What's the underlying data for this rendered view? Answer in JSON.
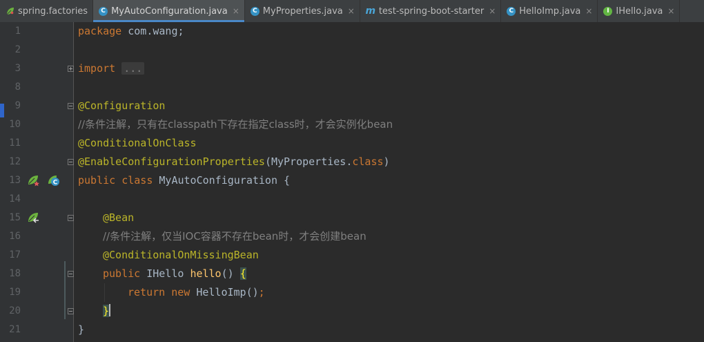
{
  "tabs": [
    {
      "label": "spring.factories",
      "icon": "spring-leaf-icon",
      "active": false,
      "closable": false
    },
    {
      "label": "MyAutoConfiguration.java",
      "icon": "class-icon",
      "icon_letter": "C",
      "active": true,
      "closable": true
    },
    {
      "label": "MyProperties.java",
      "icon": "class-icon",
      "icon_letter": "C",
      "active": false,
      "closable": true
    },
    {
      "label": "test-spring-boot-starter",
      "icon": "maven-module-icon",
      "icon_letter": "m",
      "active": false,
      "closable": true
    },
    {
      "label": "HelloImp.java",
      "icon": "class-icon",
      "icon_letter": "C",
      "active": false,
      "closable": true
    },
    {
      "label": "IHello.java",
      "icon": "interface-icon",
      "icon_letter": "I",
      "active": false,
      "closable": true
    }
  ],
  "close_glyph": "×",
  "line_numbers": [
    "1",
    "2",
    "3",
    "8",
    "9",
    "10",
    "11",
    "12",
    "13",
    "14",
    "15",
    "16",
    "17",
    "18",
    "19",
    "20",
    "21"
  ],
  "code": {
    "line1": {
      "kw": "package",
      "rest": " com.wang;"
    },
    "line3": {
      "kw": "import",
      "collapsed": "..."
    },
    "line9": {
      "ann": "@Configuration"
    },
    "line10": {
      "comment": "//条件注解，只有在classpath下存在指定class时，才会实例化bean"
    },
    "line11": {
      "ann": "@ConditionalOnClass"
    },
    "line12": {
      "ann": "@EnableConfigurationProperties",
      "open": "(",
      "arg": "MyProperties.",
      "kw": "class",
      "close": ")"
    },
    "line13": {
      "kw1": "public",
      "kw2": "class",
      "name": "MyAutoConfiguration",
      "brace": "{"
    },
    "line15": {
      "ann": "@Bean"
    },
    "line16": {
      "comment": "//条件注解，仅当IOC容器不存在bean时，才会创建bean"
    },
    "line17": {
      "ann": "@ConditionalOnMissingBean"
    },
    "line18": {
      "kw": "public",
      "type": "IHello",
      "fn": "hello",
      "parens": "()",
      "brace": "{"
    },
    "line19": {
      "kw1": "return",
      "kw2": "new",
      "call": "HelloImp()",
      "semi": ";"
    },
    "line20": {
      "brace": "}"
    },
    "line21": {
      "brace": "}"
    }
  },
  "colors": {
    "background": "#2b2b2b",
    "keyword": "#cc7832",
    "annotation": "#bbb529",
    "comment": "#808080",
    "method": "#ffc66d",
    "text": "#a9b7c6",
    "active_tab_underline": "#4a88c7"
  }
}
